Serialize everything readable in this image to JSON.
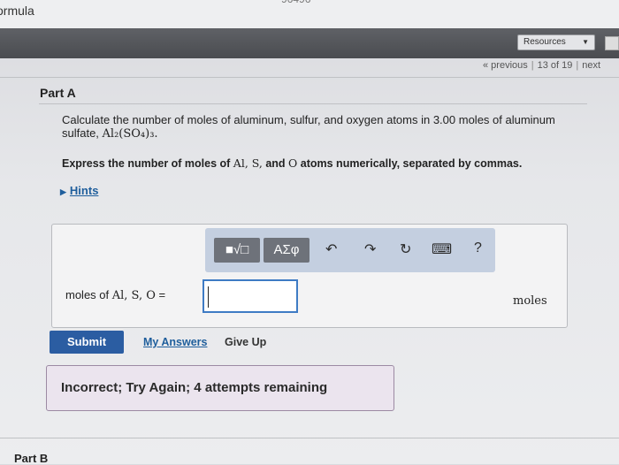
{
  "topbar": {
    "brand_fragment": "ormula",
    "item_id_fragment": "96496"
  },
  "header": {
    "resources_label": "Resources"
  },
  "nav": {
    "previous": "« previous",
    "position": "13 of 19",
    "next": "next"
  },
  "part_a": {
    "title": "Part A",
    "question_line1": "Calculate the number of moles of aluminum, sulfur, and oxygen atoms in 3.00 moles of aluminum",
    "question_line2_prefix": "sulfate, ",
    "formula": "Al₂(SO₄)₃.",
    "instruction_prefix": "Express the number of moles of ",
    "instruction_elements": "Al, S,",
    "instruction_and": " and ",
    "instruction_o": "O",
    "instruction_suffix": " atoms numerically, separated by commas."
  },
  "hints": {
    "label": "Hints"
  },
  "toolbar": {
    "template_button": "■√□",
    "symbols_button": "ΑΣφ",
    "undo_icon": "↶",
    "redo_icon": "↷",
    "reset_icon": "↻",
    "keyboard_icon": "⌨",
    "help_icon": "?"
  },
  "answer": {
    "label_prefix": "moles of ",
    "label_vars": "Al, S, O",
    "label_suffix": " =",
    "value": "",
    "units": "moles"
  },
  "actions": {
    "submit": "Submit",
    "my_answers": "My Answers",
    "give_up": "Give Up"
  },
  "feedback": {
    "message": "Incorrect; Try Again; 4 attempts remaining"
  },
  "part_b": {
    "title": "Part B"
  }
}
